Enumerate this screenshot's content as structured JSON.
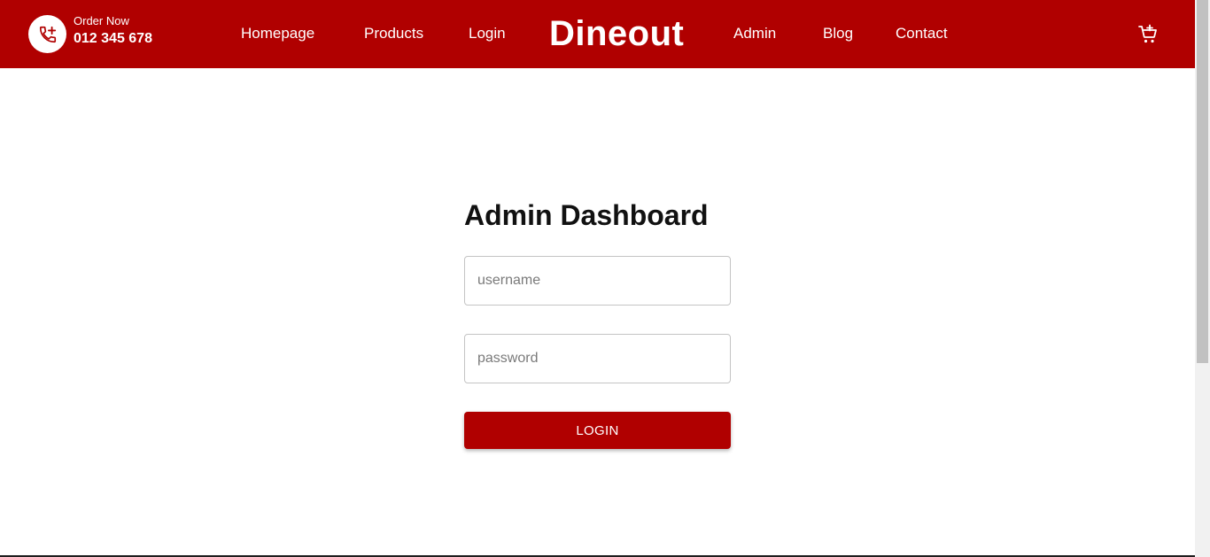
{
  "colors": {
    "brand_red": "#b00000",
    "text_dark": "#111111"
  },
  "header": {
    "phone_icon": "phone-plus-icon",
    "order_label": "Order Now",
    "order_number": "012 345 678",
    "brand": "Dineout",
    "cart_icon": "cart-plus-icon",
    "nav_links": [
      {
        "label": "Homepage"
      },
      {
        "label": "Products"
      },
      {
        "label": "Login"
      },
      {
        "label": "Admin"
      },
      {
        "label": "Blog"
      },
      {
        "label": "Contact"
      }
    ]
  },
  "main": {
    "title": "Admin Dashboard",
    "username_placeholder": "username",
    "password_placeholder": "password",
    "login_button": "LOGIN"
  }
}
